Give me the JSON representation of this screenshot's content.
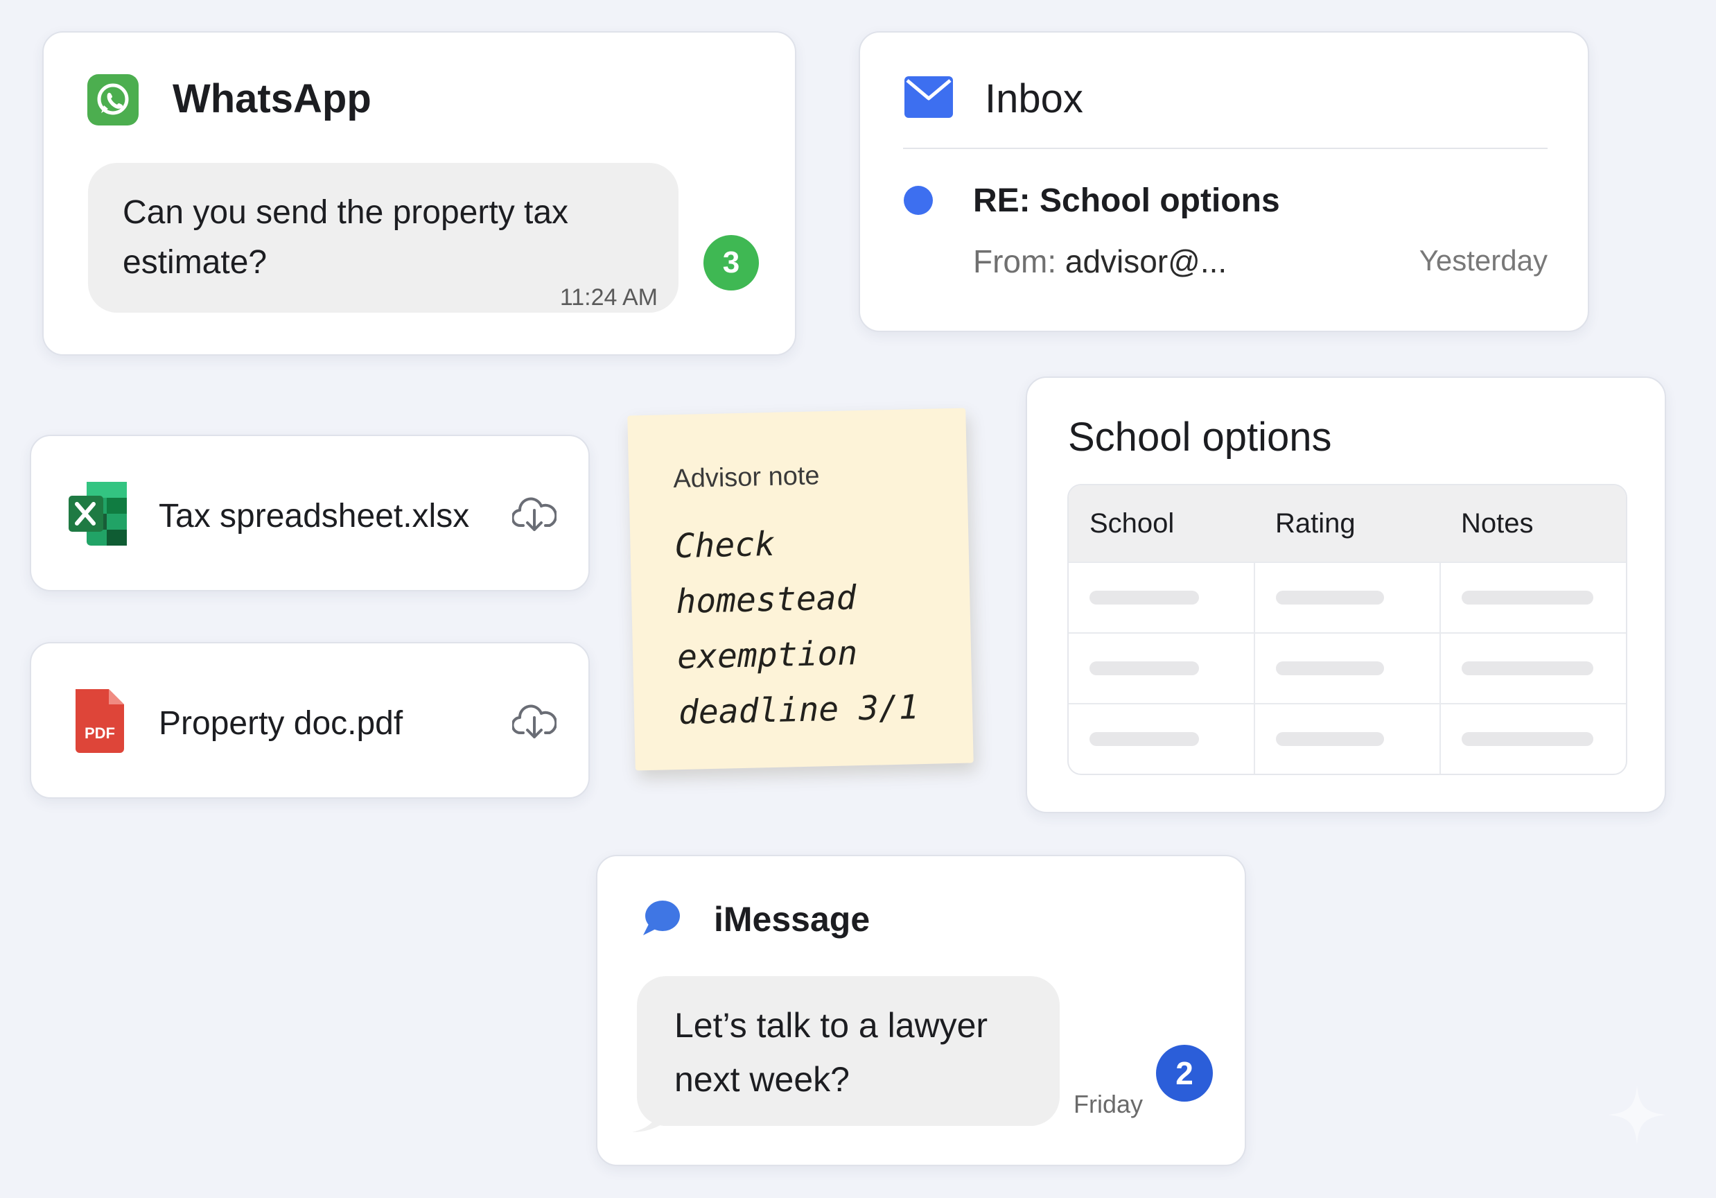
{
  "colors": {
    "background": "#f1f3f9",
    "whatsapp_green": "#4cae4f",
    "whatsapp_badge": "#3fb853",
    "inbox_blue": "#3d6ff0",
    "imessage_blue": "#3f76e4",
    "imessage_badge": "#2b5ed9",
    "sticky_note": "#fdf3d8",
    "excel_green": "#1f7a43",
    "pdf_red": "#de4539"
  },
  "whatsapp": {
    "icon": "whatsapp-icon",
    "title": "WhatsApp",
    "message": "Can you send the property tax estimate?",
    "time": "11:24 AM",
    "unread_count": "3"
  },
  "inbox": {
    "icon": "mail-icon",
    "title": "Inbox",
    "subject": "RE: School options",
    "from_label": "From:",
    "from_value": "advisor@...",
    "date": "Yesterday"
  },
  "files": [
    {
      "icon": "excel-icon",
      "name": "Tax spreadsheet.xlsx",
      "action_icon": "cloud-download-icon"
    },
    {
      "icon": "pdf-icon",
      "name": "Property doc.pdf",
      "icon_label": "PDF",
      "action_icon": "cloud-download-icon"
    }
  ],
  "note": {
    "label": "Advisor note",
    "text": "Check homestead exemption deadline 3/1"
  },
  "school_options": {
    "title": "School options",
    "columns": [
      "School",
      "Rating",
      "Notes"
    ],
    "row_count": 3
  },
  "imessage": {
    "icon": "chat-bubble-icon",
    "title": "iMessage",
    "message": "Let’s talk to a lawyer next week?",
    "date": "Friday",
    "unread_count": "2"
  }
}
